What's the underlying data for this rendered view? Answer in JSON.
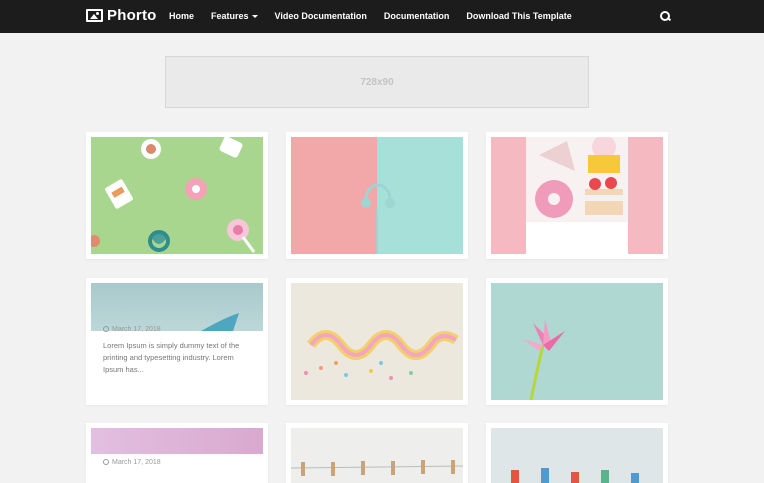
{
  "nav": {
    "logo_text": "Phorto",
    "items": [
      {
        "label": "Home"
      },
      {
        "label": "Features"
      },
      {
        "label": "Video Documentation"
      },
      {
        "label": "Documentation"
      },
      {
        "label": "Download This Template"
      }
    ]
  },
  "ad": {
    "label": "728x90"
  },
  "posts": [
    {
      "date": "March 17, 2018",
      "excerpt": "Lorem Ipsum is simply dummy text of the printing and typesetting industry. Lorem Ipsum has..."
    },
    {
      "date": "March 17, 2018"
    }
  ],
  "colors": {
    "nav_bg": "#1c1c1c",
    "page_bg": "#f2f2f2",
    "card_bg": "#ffffff"
  }
}
